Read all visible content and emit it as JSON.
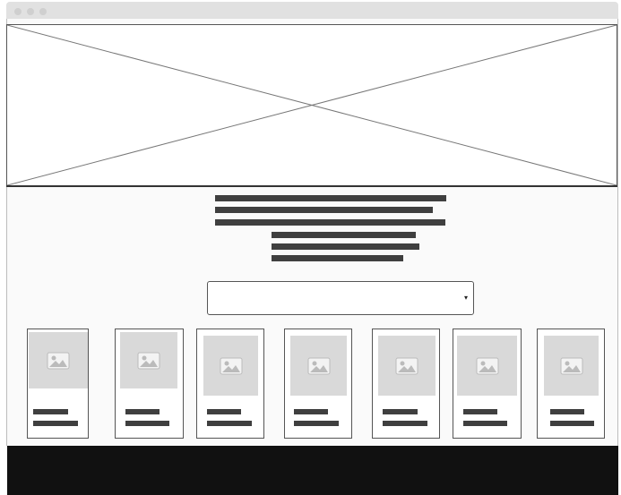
{
  "window": {
    "controls": [
      "close-dot",
      "minimize-dot",
      "maximize-dot"
    ]
  },
  "hero": {
    "placeholder": "image-placeholder"
  },
  "select": {
    "arrow_icon": "dropdown-arrow-icon",
    "arrow_glyph": "▾",
    "value": ""
  },
  "cards": [
    {
      "thumb_icon": "image-icon"
    },
    {
      "thumb_icon": "image-icon"
    },
    {
      "thumb_icon": "image-icon"
    },
    {
      "thumb_icon": "image-icon"
    },
    {
      "thumb_icon": "image-icon"
    },
    {
      "thumb_icon": "image-icon"
    },
    {
      "thumb_icon": "image-icon"
    }
  ],
  "colors": {
    "footer": "#111111",
    "text_bar": "#3f3f3f",
    "thumb_bg": "#d9d9d9",
    "titlebar": "#e1e1e1"
  }
}
